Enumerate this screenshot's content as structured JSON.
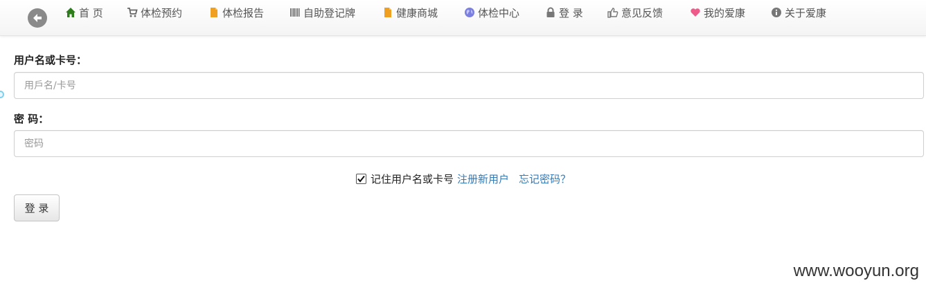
{
  "nav": {
    "items": [
      {
        "label": "首 页",
        "icon": "home-icon",
        "color": "#2d7d1a"
      },
      {
        "label": "体检预约",
        "icon": "cart-icon",
        "color": "#666666"
      },
      {
        "label": "体检报告",
        "icon": "document-icon",
        "color": "#f0a020"
      },
      {
        "label": "自助登记牌",
        "icon": "barcode-icon",
        "color": "#666666"
      },
      {
        "label": "健康商城",
        "icon": "document-icon",
        "color": "#f0a020"
      },
      {
        "label": "体检中心",
        "icon": "globe-icon",
        "color": "#7b7fe0"
      },
      {
        "label": "登 录",
        "icon": "lock-icon",
        "color": "#777777"
      },
      {
        "label": "意见反馈",
        "icon": "thumbs-up-icon",
        "color": "#777777"
      },
      {
        "label": "我的爱康",
        "icon": "heart-icon",
        "color": "#ee5a8a"
      },
      {
        "label": "关于爱康",
        "icon": "info-icon",
        "color": "#777777"
      }
    ]
  },
  "form": {
    "username_label": "用户名或卡号：",
    "username_placeholder": "用戶名/卡号",
    "password_label": "密 码：",
    "password_placeholder": "密码",
    "remember_checked": true,
    "remember_label": "记住用户名或卡号",
    "register_link": "注册新用户",
    "forgot_link": "忘记密码？",
    "login_button": "登 录"
  },
  "colors": {
    "link": "#337ab7"
  },
  "watermark": "www.wooyun.org"
}
